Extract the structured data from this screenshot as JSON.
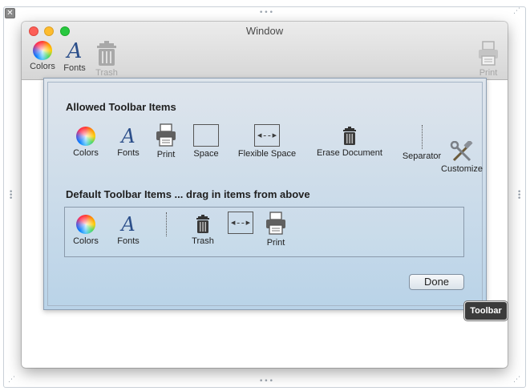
{
  "window": {
    "title": "Window"
  },
  "toolbar": {
    "items": [
      {
        "label": "Colors",
        "icon": "color-wheel-icon"
      },
      {
        "label": "Fonts",
        "icon": "fonts-icon"
      },
      {
        "label": "Trash",
        "icon": "trash-icon",
        "enabled": false
      },
      {
        "label": "Print",
        "icon": "printer-icon",
        "enabled": false
      }
    ]
  },
  "sheet": {
    "allowed_title": "Allowed Toolbar Items",
    "allowed": [
      {
        "label": "Colors"
      },
      {
        "label": "Fonts"
      },
      {
        "label": "Print"
      },
      {
        "label": "Space"
      },
      {
        "label": "Flexible Space"
      },
      {
        "label": "Erase Document"
      },
      {
        "label": "Separator"
      },
      {
        "label": "Customize"
      }
    ],
    "default_title": "Default Toolbar Items ... drag in items from above",
    "defaults": [
      {
        "label": "Colors"
      },
      {
        "label": "Fonts"
      },
      {
        "label": "Trash"
      },
      {
        "label": "Print"
      }
    ],
    "done_label": "Done"
  },
  "tooltip": {
    "text": "Toolbar"
  },
  "colors": {
    "accent": "#b9d3e8",
    "window_bg": "#ececec"
  }
}
